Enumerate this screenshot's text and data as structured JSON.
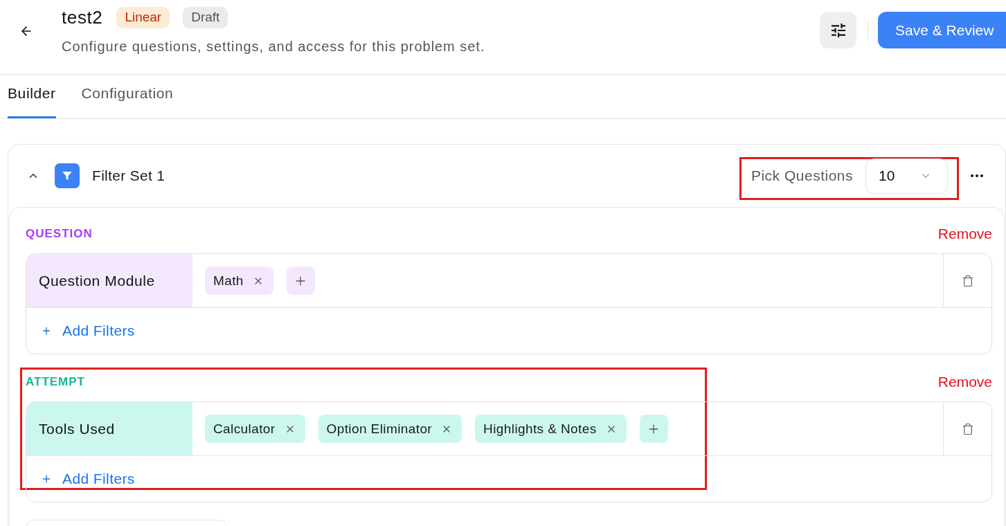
{
  "header": {
    "title": "test2",
    "badges": [
      {
        "label": "Linear",
        "kind": "mode"
      },
      {
        "label": "Draft",
        "kind": "status"
      }
    ],
    "subtitle": "Configure questions, settings, and access for this problem set.",
    "primary_button": "Save & Review"
  },
  "tabs": [
    {
      "label": "Builder",
      "selected": true
    },
    {
      "label": "Configuration",
      "selected": false
    }
  ],
  "filter_sets": [
    {
      "title": "Filter Set 1",
      "expanded": true,
      "pick_questions": {
        "label": "Pick Questions",
        "value": "10",
        "highlighted": true
      },
      "groups": [
        {
          "kind": "question",
          "heading": "QUESTION",
          "remove": "Remove",
          "highlighted": false,
          "rules": [
            {
              "field": "Question Module",
              "values": [
                "Math"
              ]
            }
          ],
          "add_filters": "Add Filters"
        },
        {
          "kind": "attempt",
          "heading": "ATTEMPT",
          "remove": "Remove",
          "highlighted": true,
          "rules": [
            {
              "field": "Tools Used",
              "values": [
                "Calculator",
                "Option Eliminator",
                "Highlights & Notes"
              ]
            }
          ],
          "add_filters": "Add Filters"
        }
      ]
    }
  ]
}
